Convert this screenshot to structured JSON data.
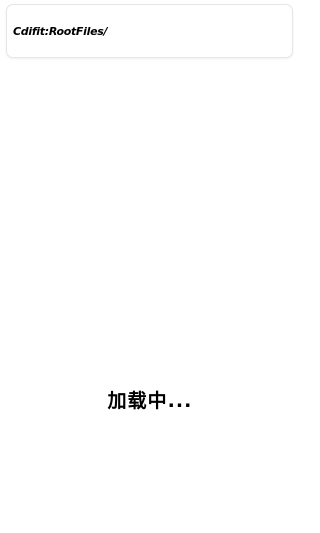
{
  "header": {
    "path": "Cdifit:RootFiles/"
  },
  "main": {
    "loading_text": "加载中..."
  }
}
